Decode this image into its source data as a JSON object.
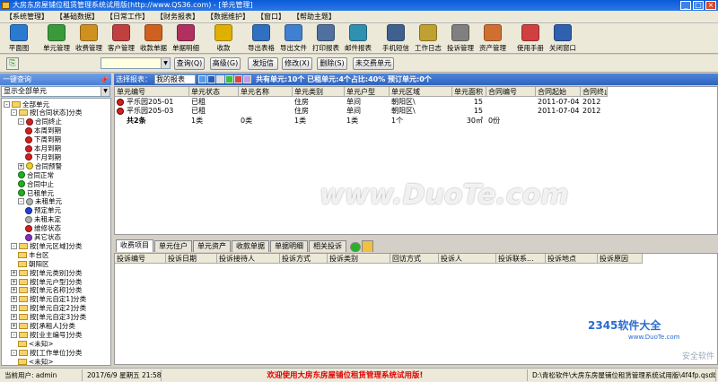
{
  "window": {
    "title": "大房东房屋铺位租赁管理系统试用版(http://www.QS36.com) - [单元管理]"
  },
  "menu": [
    "【系统管理】",
    "【基础数据】",
    "【日常工作】",
    "【财务报表】",
    "【数据维护】",
    "【窗口】",
    "【帮助主题】"
  ],
  "toolbar": [
    {
      "label": "平面图",
      "icon": "floorplan-icon",
      "color": "#2a7ad0"
    },
    {
      "label": "单元管理",
      "icon": "unit-icon",
      "color": "#3a9a3a"
    },
    {
      "label": "收费管理",
      "icon": "fee-icon",
      "color": "#d09020"
    },
    {
      "label": "客户管理",
      "icon": "customer-icon",
      "color": "#c04040"
    },
    {
      "label": "收款单据",
      "icon": "receipt-icon",
      "color": "#d06020"
    },
    {
      "label": "单据明细",
      "icon": "detail-icon",
      "color": "#b03060"
    },
    {
      "label": "收款",
      "icon": "payment-icon",
      "color": "#e0b000"
    },
    {
      "label": "导出表格",
      "icon": "export-table-icon",
      "color": "#3070c0"
    },
    {
      "label": "导出文件",
      "icon": "export-file-icon",
      "color": "#4080d0"
    },
    {
      "label": "打印报表",
      "icon": "print-icon",
      "color": "#5070a0"
    },
    {
      "label": "邮件报表",
      "icon": "mail-icon",
      "color": "#3090b0"
    },
    {
      "label": "手机短信",
      "icon": "sms-icon",
      "color": "#406090"
    },
    {
      "label": "工作日志",
      "icon": "worklog-icon",
      "color": "#c0a030"
    },
    {
      "label": "投诉管理",
      "icon": "complaint-icon",
      "color": "#808080"
    },
    {
      "label": "资产管理",
      "icon": "asset-icon",
      "color": "#d07030"
    },
    {
      "label": "使用手册",
      "icon": "manual-icon",
      "color": "#d04040"
    },
    {
      "label": "关闭窗口",
      "icon": "close-window-icon",
      "color": "#3060b0"
    }
  ],
  "query": {
    "input_value": "",
    "buttons": [
      "查询(Q)",
      "高级(G)",
      "发短信",
      "修改(X)",
      "删除(S)",
      "未交费单元"
    ]
  },
  "left": {
    "header": "一键查询",
    "select_value": "显示全部单元",
    "tree": [
      {
        "label": "全部单元",
        "level": 0,
        "kind": "folder",
        "exp": "-"
      },
      {
        "label": "按[合同状态]分类",
        "level": 1,
        "kind": "folder",
        "exp": "-"
      },
      {
        "label": "合同终止",
        "level": 2,
        "kind": "red",
        "exp": "-"
      },
      {
        "label": "本周到期",
        "level": 3,
        "kind": "red"
      },
      {
        "label": "下周到期",
        "level": 3,
        "kind": "red"
      },
      {
        "label": "本月到期",
        "level": 3,
        "kind": "red"
      },
      {
        "label": "下月到期",
        "level": 3,
        "kind": "red"
      },
      {
        "label": "合同预警",
        "level": 2,
        "kind": "yellow",
        "exp": "+"
      },
      {
        "label": "合同正常",
        "level": 2,
        "kind": "green"
      },
      {
        "label": "合同中止",
        "level": 2,
        "kind": "green"
      },
      {
        "label": "已租单元",
        "level": 2,
        "kind": "green"
      },
      {
        "label": "未租单元",
        "level": 2,
        "kind": "gray",
        "exp": "-"
      },
      {
        "label": "预定单元",
        "level": 3,
        "kind": "blue"
      },
      {
        "label": "未租未定",
        "level": 3,
        "kind": "gray"
      },
      {
        "label": "维修状态",
        "level": 3,
        "kind": "red"
      },
      {
        "label": "其它状态",
        "level": 3,
        "kind": "purple"
      },
      {
        "label": "按[单元区域]分类",
        "level": 1,
        "kind": "folder",
        "exp": "-"
      },
      {
        "label": "丰台区",
        "level": 2,
        "kind": "folder"
      },
      {
        "label": "朝阳区",
        "level": 2,
        "kind": "folder"
      },
      {
        "label": "按[单元类别]分类",
        "level": 1,
        "kind": "folder",
        "exp": "+"
      },
      {
        "label": "按[单元户型]分类",
        "level": 1,
        "kind": "folder",
        "exp": "+"
      },
      {
        "label": "按[单元名称]分类",
        "level": 1,
        "kind": "folder",
        "exp": "+"
      },
      {
        "label": "按[单元自定1]分类",
        "level": 1,
        "kind": "folder",
        "exp": "+"
      },
      {
        "label": "按[单元自定2]分类",
        "level": 1,
        "kind": "folder",
        "exp": "+"
      },
      {
        "label": "按[单元自定3]分类",
        "level": 1,
        "kind": "folder",
        "exp": "+"
      },
      {
        "label": "按[承租人]分类",
        "level": 1,
        "kind": "folder",
        "exp": "+"
      },
      {
        "label": "按[业主编号]分类",
        "level": 1,
        "kind": "folder",
        "exp": "-"
      },
      {
        "label": "<未知>",
        "level": 2,
        "kind": "folder"
      },
      {
        "label": "按[工作单位]分类",
        "level": 1,
        "kind": "folder",
        "exp": "-"
      },
      {
        "label": "<未知>",
        "level": 2,
        "kind": "folder"
      }
    ]
  },
  "grid": {
    "select_label": "选择报表：",
    "select_value": "我的报表",
    "stats": "共有单元:10个 已租单元:4个占比:40% 预订单元:0个",
    "columns": [
      "单元编号",
      "单元状态",
      "单元名称",
      "单元类别",
      "单元户型",
      "单元区域",
      "单元面积",
      "合同编号",
      "合同起始",
      "合同终止"
    ],
    "rows": [
      [
        "平乐园205-01",
        "已租",
        "",
        "住房",
        "单间",
        "朝阳区\\",
        "15",
        "",
        "2011-07-04",
        "2012"
      ],
      [
        "平乐园205-03",
        "已租",
        "",
        "住房",
        "单间",
        "朝阳区\\",
        "15",
        "",
        "2011-07-04",
        "2012"
      ]
    ],
    "total": [
      "共2条",
      "1类",
      "0类",
      "1类",
      "1类",
      "1个",
      "30㎡",
      "0份",
      "",
      ""
    ]
  },
  "tabs": [
    "收费项目",
    "单元住户",
    "单元资产",
    "收款单据",
    "单据明细",
    "相关投诉"
  ],
  "subgrid": {
    "columns": [
      "投诉编号",
      "投诉日期",
      "投诉接待人",
      "投诉方式",
      "投诉类别",
      "回访方式",
      "投诉人",
      "投诉联系...",
      "投诉地点",
      "投诉原因"
    ]
  },
  "status": {
    "user": "当前用户: admin",
    "datetime": "2017/6/9 星期五 21:58:12",
    "welcome": "欢迎使用大房东房屋铺位租赁管理系统试用版!",
    "path": "D:\\青松软件\\大房东房屋铺位租赁管理系统试用版\\4f4fp.qsdb"
  },
  "watermark": "www.DuoTe.com",
  "logo": {
    "main": "2345软件大全",
    "sub": "www.DuoTe.com",
    "small": "安全软件"
  }
}
